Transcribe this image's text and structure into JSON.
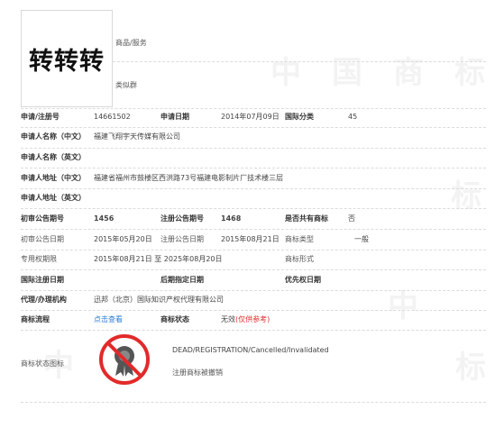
{
  "logo_text": "转转转",
  "header": {
    "goods_label": "商品/服务",
    "similar_label": "类似群"
  },
  "row1": {
    "reg_no_label": "申请/注册号",
    "reg_no": "14661502",
    "app_date_label": "申请日期",
    "app_date": "2014年07月09日",
    "intl_class_label": "国际分类",
    "intl_class": "45"
  },
  "applicant_cn_label": "申请人名称（中文）",
  "applicant_cn": "福建飞翔宇天传媒有限公司",
  "applicant_en_label": "申请人名称（英文）",
  "address_cn_label": "申请人地址（中文）",
  "address_cn": "福建省福州市鼓楼区西洪路73号福建电影制片厂技术楼三层",
  "address_en_label": "申请人地址（英文）",
  "row_pub": {
    "first_pub_no_label": "初审公告期号",
    "first_pub_no": "1456",
    "reg_pub_no_label": "注册公告期号",
    "reg_pub_no": "1468",
    "shared_label": "是否共有商标",
    "shared": "否"
  },
  "row_dates": {
    "first_pub_date_label": "初审公告日期",
    "first_pub_date": "2015年05月20日",
    "reg_pub_date_label": "注册公告日期",
    "reg_pub_date": "2015年08月21日",
    "tm_type_label": "商标类型",
    "tm_type": "一般"
  },
  "row_period": {
    "period_label": "专用权期限",
    "period": "2015年08月21日 至 2025年08月20日",
    "tm_form_label": "商标形式"
  },
  "row_intl": {
    "intl_reg_date_label": "国际注册日期",
    "later_date_label": "后期指定日期",
    "priority_date_label": "优先权日期"
  },
  "agent_label": "代理/办理机构",
  "agent": "迅邦（北京）国际知识产权代理有限公司",
  "row_process": {
    "process_label": "商标流程",
    "process_link": "点击查看",
    "status_label": "商标状态",
    "status": "无效",
    "status_note": "(仅供参考)"
  },
  "status_icon_label": "商标状态图标",
  "status_en": "DEAD/REGISTRATION/Cancelled/Invalidated",
  "status_cn": "注册商标被撤销",
  "watermark": [
    "中",
    "国",
    "商",
    "标"
  ],
  "colors": {
    "link": "#2a7bd6",
    "alert": "#e22a2a"
  }
}
